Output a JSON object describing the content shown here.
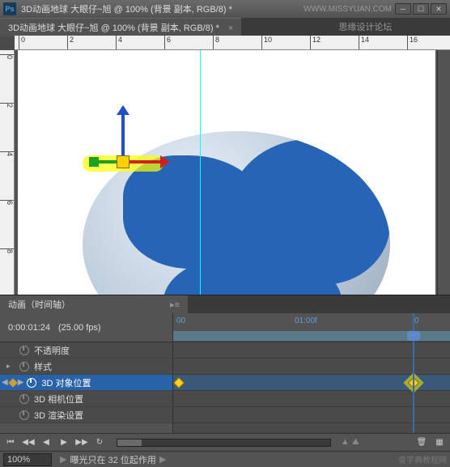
{
  "titlebar": {
    "app_icon": "Ps",
    "title": "3D动画地球   大眼仔~旭 @ 100% (背景 副本, RGB/8) *",
    "watermark": "WWW.MISSYUAN.COM"
  },
  "tab": {
    "label": "3D动画地球   大眼仔~旭 @ 100% (背景 副本, RGB/8) *",
    "close": "×",
    "forum": "思缘设计论坛"
  },
  "ruler_h": [
    "0",
    "2",
    "4",
    "6",
    "8",
    "10",
    "12",
    "14",
    "16"
  ],
  "ruler_v": [
    "0",
    "2",
    "4",
    "6",
    "8"
  ],
  "panel": {
    "tab_label": "动画（时间轴）",
    "timecode": "0:00:01:24",
    "fps": "(25.00 fps)",
    "time_marks": {
      "t0": "00",
      "t1": "01:00f",
      "t2": "0"
    },
    "tracks": [
      {
        "label": "不透明度",
        "selected": false
      },
      {
        "label": "样式",
        "selected": false
      },
      {
        "label": "3D 对象位置",
        "selected": true
      },
      {
        "label": "3D 相机位置",
        "selected": false
      },
      {
        "label": "3D 渲染设置",
        "selected": false
      }
    ]
  },
  "controls": {
    "rewind": "⏮",
    "prev": "◀◀",
    "playrev": "◀",
    "play": "▶",
    "next": "▶▶",
    "end": "⏭",
    "loop": "↻"
  },
  "statusbar": {
    "zoom": "100%",
    "message": "曝光只在 32 位起作用",
    "watermark": "查字典教程网"
  }
}
